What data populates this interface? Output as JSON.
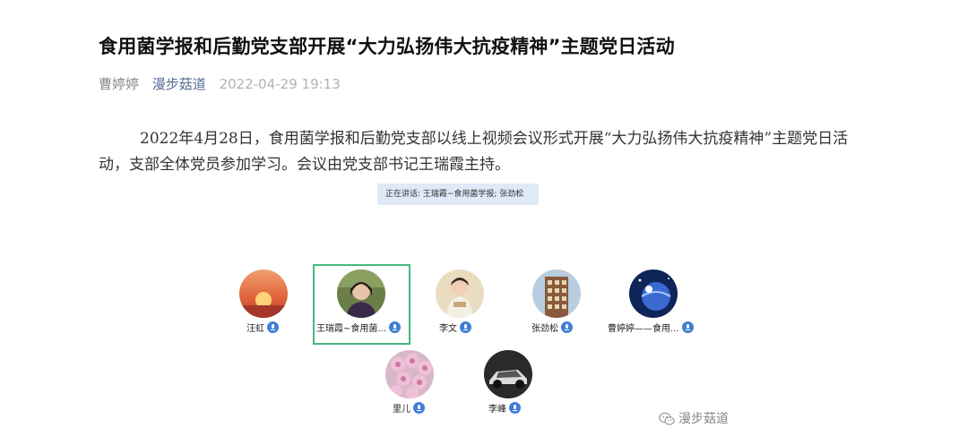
{
  "article": {
    "title": "食用菌学报和后勤党支部开展“大力弘扬伟大抗疫精神”主题党日活动",
    "author": "曹婷婷",
    "account": "漫步菇道",
    "datetime": "2022-04-29 19:13",
    "paragraph": "2022年4月28日，食用菌学报和后勤党支部以线上视频会议形式开展“大力弘扬伟大抗疫精神”主题党日活动，支部全体党员参加学习。会议由党支部书记王瑞霞主持。"
  },
  "meeting": {
    "speaking_label": "正在讲话: 王瑞霞~食用菌学报; 张劲松",
    "participants": [
      {
        "name": "汪虹",
        "avatar": "sunset-avatar",
        "color": "#e8734a"
      },
      {
        "name": "王瑞霞~食用菌...",
        "avatar": "woman-portrait-avatar",
        "color": "#5a6b3a",
        "active": true
      },
      {
        "name": "李文",
        "avatar": "child-avatar",
        "color": "#d9c49a"
      },
      {
        "name": "张劲松",
        "avatar": "building-avatar",
        "color": "#8a6a4a"
      },
      {
        "name": "曹婷婷——食用...",
        "avatar": "planet-avatar",
        "color": "#1c3a7a"
      },
      {
        "name": "里儿",
        "avatar": "flowers-avatar",
        "color": "#e3a8c8"
      },
      {
        "name": "李峰",
        "avatar": "car-avatar",
        "color": "#3a3a3a"
      }
    ]
  },
  "watermark": {
    "label": "漫步菇道",
    "icon": "wechat-icon"
  }
}
